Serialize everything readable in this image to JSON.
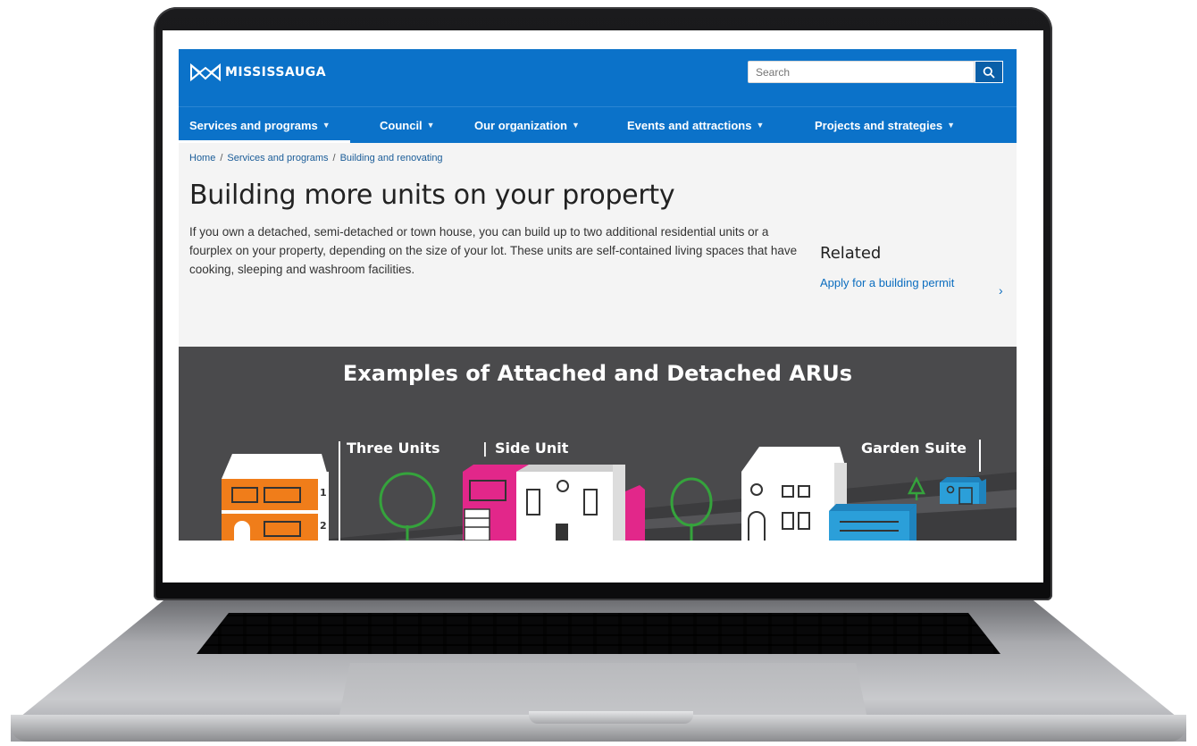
{
  "site": {
    "logo_text": "MISSISSAUGA",
    "search_placeholder": "Search"
  },
  "nav": [
    {
      "label": "Services and programs",
      "active": true
    },
    {
      "label": "Council"
    },
    {
      "label": "Our organization"
    },
    {
      "label": "Events and attractions"
    },
    {
      "label": "Projects and strategies"
    }
  ],
  "breadcrumb": [
    "Home",
    "Services and programs",
    "Building and renovating"
  ],
  "page": {
    "title": "Building more units on your property",
    "intro": "If you own a detached, semi-detached or town house, you can build up to two additional residential units or a fourplex on your property, depending on the size of your lot. These units are self-contained living spaces that have cooking, sleeping and washroom facilities."
  },
  "related": {
    "heading": "Related",
    "link": "Apply for a building permit"
  },
  "graphic": {
    "title": "Examples of Attached and Detached ARUs",
    "labels": [
      "Three Units",
      "Side Unit",
      "Garden Suite"
    ],
    "unit_numbers": [
      "1",
      "2"
    ]
  },
  "colors": {
    "brand_blue": "#0b72c9",
    "graphic_bg": "#4a4a4c",
    "orange": "#f07d1a",
    "magenta": "#e2278a",
    "green": "#35a33c",
    "cyan": "#2b9fd9"
  }
}
